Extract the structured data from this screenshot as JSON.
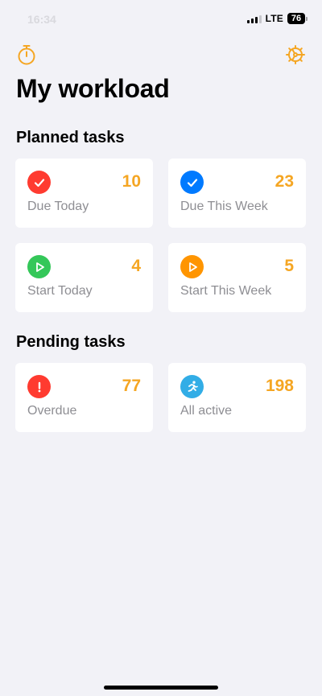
{
  "status_bar": {
    "time": "16:34",
    "network": "LTE",
    "battery": "76"
  },
  "header": {
    "left_icon": "stopwatch-icon",
    "right_icon": "gear-icon",
    "title": "My workload"
  },
  "sections": {
    "planned": {
      "title": "Planned tasks",
      "cards": [
        {
          "label": "Due Today",
          "count": "10",
          "icon": "checkmark-icon",
          "color": "#ff3b30"
        },
        {
          "label": "Due This Week",
          "count": "23",
          "icon": "checkmark-icon",
          "color": "#007aff"
        },
        {
          "label": "Start Today",
          "count": "4",
          "icon": "play-icon",
          "color": "#34c759"
        },
        {
          "label": "Start This Week",
          "count": "5",
          "icon": "play-icon",
          "color": "#ff9500"
        }
      ]
    },
    "pending": {
      "title": "Pending tasks",
      "cards": [
        {
          "label": "Overdue",
          "count": "77",
          "icon": "exclamation-icon",
          "color": "#ff3b30"
        },
        {
          "label": "All active",
          "count": "198",
          "icon": "running-figure-icon",
          "color": "#32ade6"
        }
      ]
    }
  },
  "colors": {
    "accent": "#f5a623",
    "background": "#f2f2f7",
    "card": "#ffffff",
    "label": "#8e8e93"
  }
}
